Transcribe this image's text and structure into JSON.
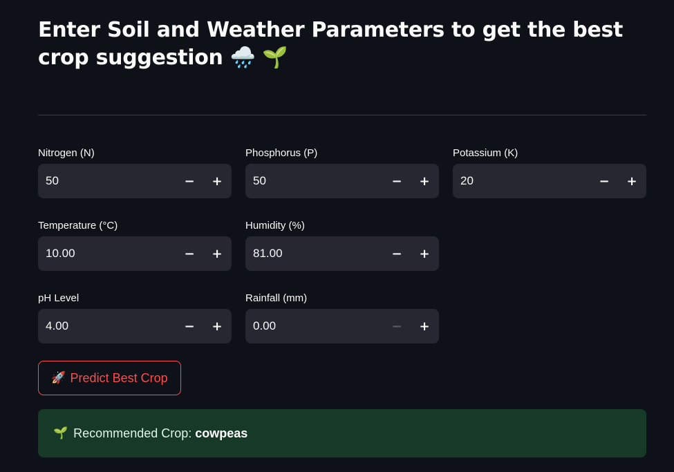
{
  "header": {
    "title": "Enter Soil and Weather Parameters to get the best crop suggestion",
    "title_emoji": "🌧️ 🌱"
  },
  "fields": {
    "nitrogen": {
      "label": "Nitrogen (N)",
      "value": "50"
    },
    "phosphorus": {
      "label": "Phosphorus (P)",
      "value": "50"
    },
    "potassium": {
      "label": "Potassium (K)",
      "value": "20"
    },
    "temperature": {
      "label": "Temperature (°C)",
      "value": "10.00"
    },
    "humidity": {
      "label": "Humidity (%)",
      "value": "81.00"
    },
    "ph": {
      "label": "pH Level",
      "value": "4.00"
    },
    "rainfall": {
      "label": "Rainfall (mm)",
      "value": "0.00"
    }
  },
  "stepper": {
    "minus": "−",
    "plus": "+"
  },
  "predict_button": {
    "emoji": "🚀",
    "label": "Predict Best Crop"
  },
  "result": {
    "emoji": "🌱",
    "label": "Recommended Crop:",
    "crop": "cowpeas"
  },
  "colors": {
    "background": "#0e1117",
    "input_bg": "#262730",
    "accent": "#ff4b4b",
    "success_bg": "#173928"
  }
}
